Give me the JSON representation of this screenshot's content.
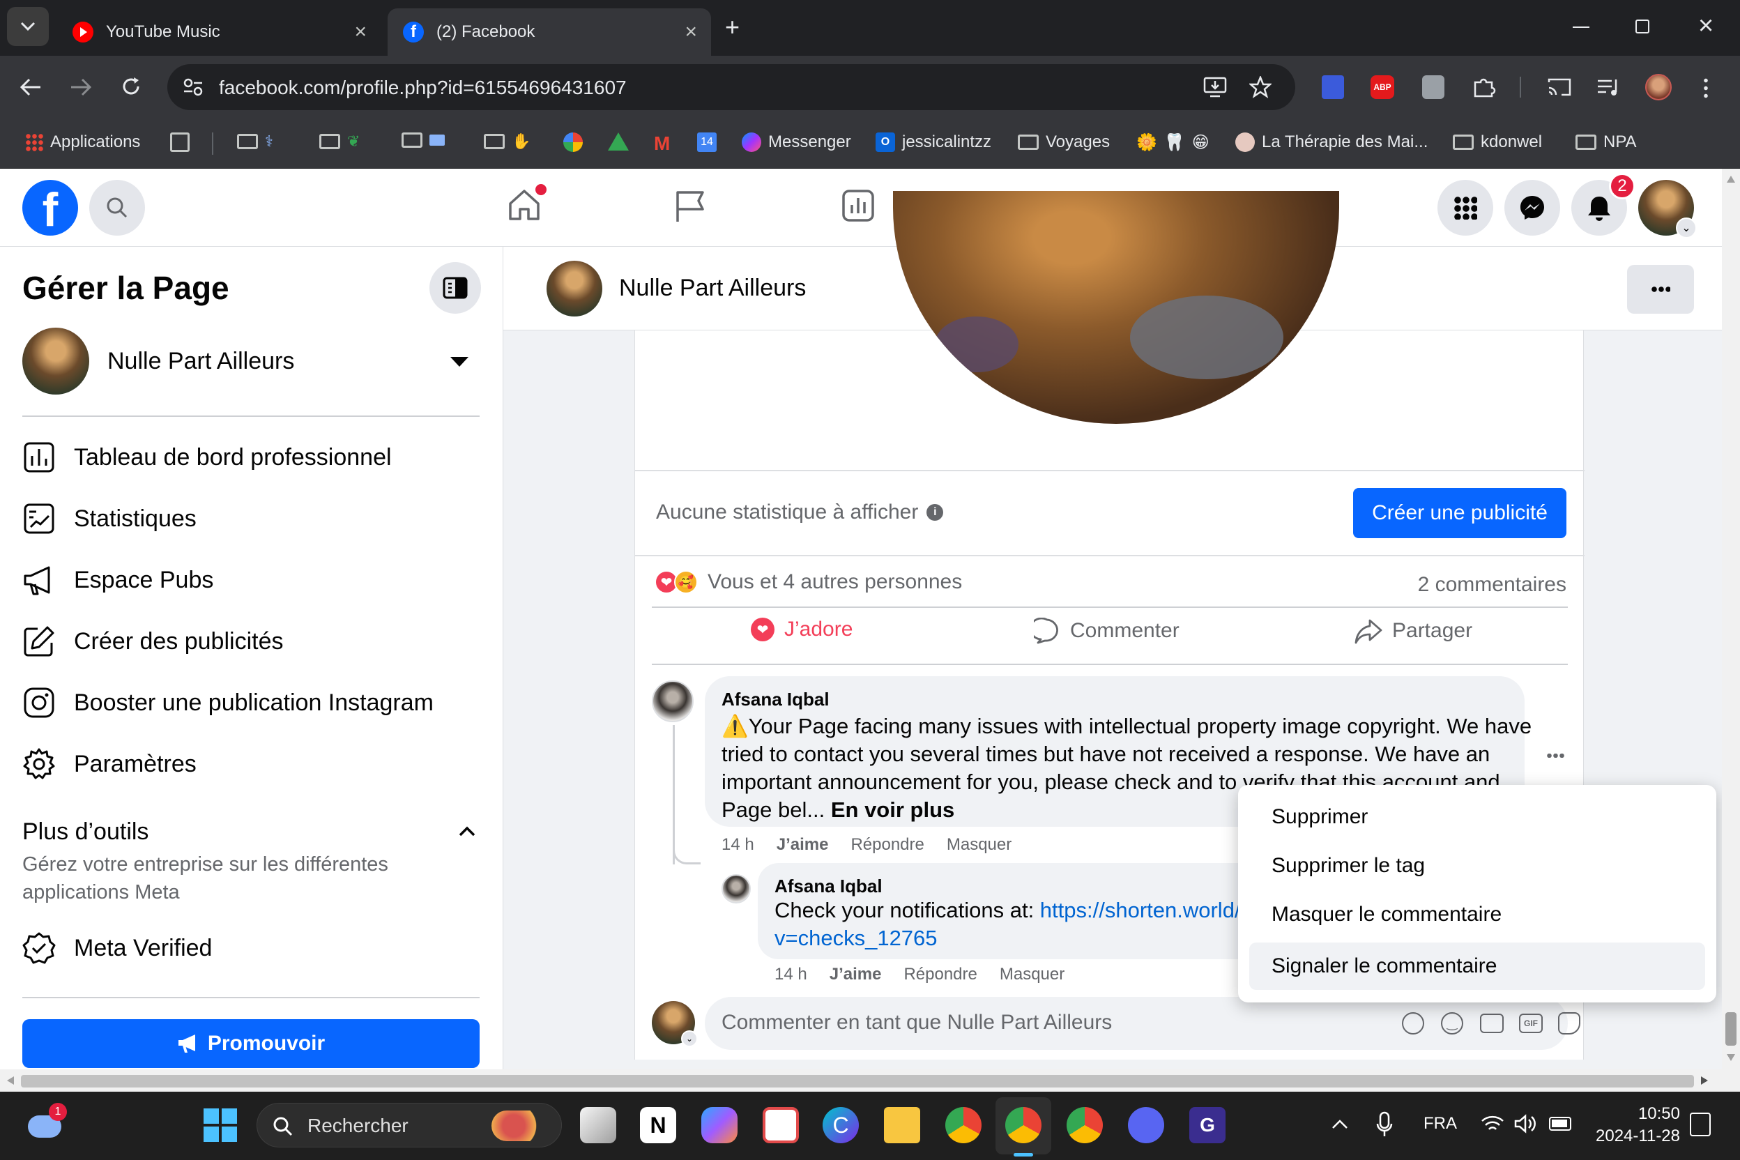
{
  "browser": {
    "tabs": [
      {
        "title": "YouTube Music",
        "active": false
      },
      {
        "title": "(2) Facebook",
        "active": true
      }
    ],
    "url": "facebook.com/profile.php?id=61554696431607",
    "bookmarks": [
      "Applications",
      "Messenger",
      "jessicalintzz",
      "Voyages",
      "La Thérapie des Mai...",
      "kdonwel",
      "NPA"
    ]
  },
  "fb_header": {
    "notification_count": "2"
  },
  "left_panel": {
    "title": "Gérer la Page",
    "page_name": "Nulle Part Ailleurs",
    "menu": [
      {
        "label": "Tableau de bord professionnel",
        "icon": "dashboard-icon"
      },
      {
        "label": "Statistiques",
        "icon": "insights-icon"
      },
      {
        "label": "Espace Pubs",
        "icon": "megaphone-icon"
      },
      {
        "label": "Créer des publicités",
        "icon": "edit-icon"
      },
      {
        "label": "Booster une publication Instagram",
        "icon": "instagram-icon"
      },
      {
        "label": "Paramètres",
        "icon": "gear-icon"
      }
    ],
    "more_tools_title": "Plus d’outils",
    "more_tools_desc": "Gérez votre entreprise sur les différentes applications Meta",
    "meta_verified": "Meta Verified",
    "promote_button": "Promouvoir"
  },
  "page_bar": {
    "name": "Nulle Part Ailleurs"
  },
  "post": {
    "stats_text": "Aucune statistique à afficher",
    "create_ad_button": "Créer une publicité",
    "reactions_text": "Vous et 4 autres personnes",
    "comments_count": "2 commentaires",
    "actions": {
      "like": "J’adore",
      "comment": "Commenter",
      "share": "Partager"
    },
    "comments": [
      {
        "author": "Afsana Iqbal",
        "lines": [
          "⚠️Your Page facing many issues with intellectual property image copyright. We have",
          "tried to contact you several times but have not received a response. We have an",
          "important announcement for you, please check and to verify that this account and"
        ],
        "last_line": "Page bel...",
        "see_more": "En voir plus",
        "time": "14 h",
        "like": "J’aime",
        "reply": "Répondre",
        "hide": "Masquer"
      },
      {
        "author": "Afsana Iqbal",
        "text_prefix": "Check your notifications at: ",
        "link_line1": "https://shorten.world/",
        "link_line2": "v=checks_12765",
        "time": "14 h",
        "like": "J’aime",
        "reply": "Répondre",
        "hide": "Masquer"
      }
    ],
    "comment_placeholder": "Commenter en tant que Nulle Part Ailleurs"
  },
  "context_menu": {
    "items": [
      "Supprimer",
      "Supprimer le tag",
      "Masquer le commentaire",
      "Signaler le commentaire"
    ],
    "hovered_index": 3
  },
  "taskbar": {
    "weather_badge": "1",
    "search_placeholder": "Rechercher",
    "language": "FRA",
    "time": "10:50",
    "date": "2024-11-28"
  },
  "colors": {
    "fb_blue": "#0866ff",
    "love_red": "#f33e58",
    "text_secondary": "#65676b",
    "link": "#0064d1"
  }
}
